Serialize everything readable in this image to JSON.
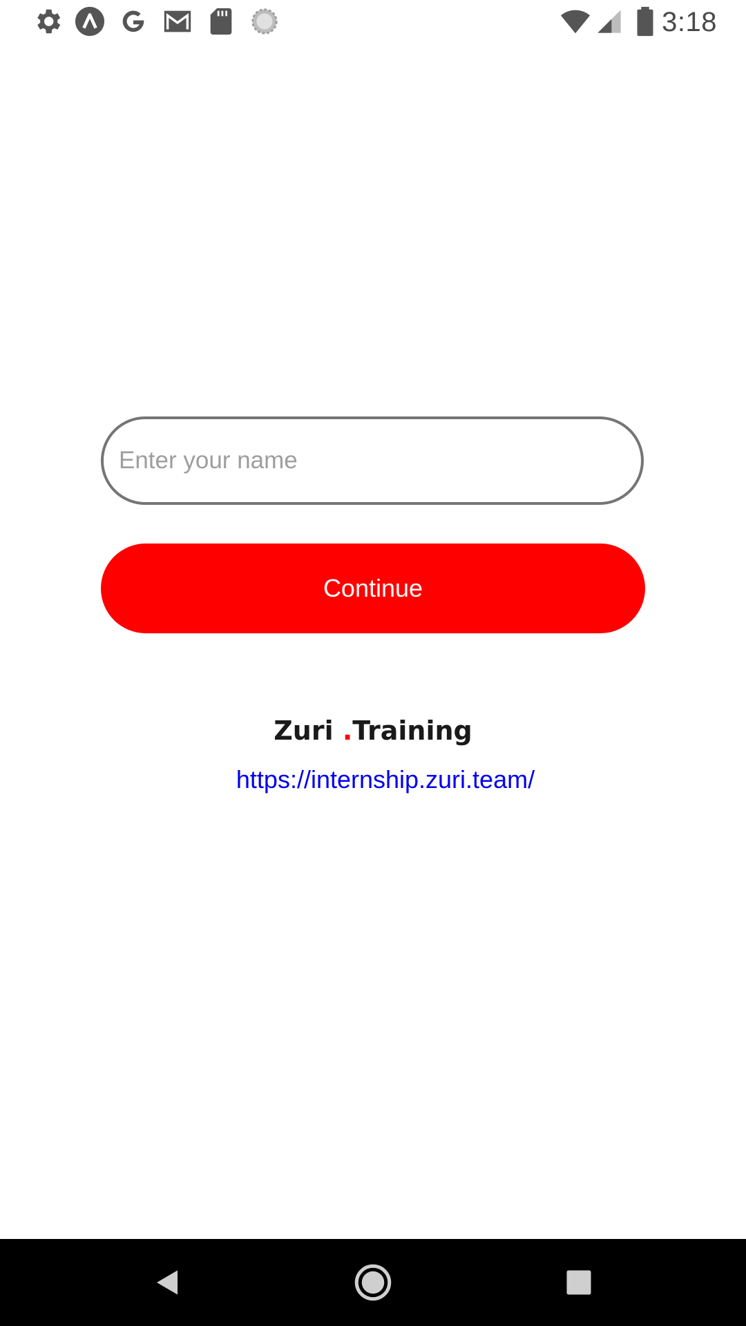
{
  "status_bar": {
    "time": "3:18",
    "left_icons": [
      "gear-icon",
      "lambda-icon",
      "google-icon",
      "gmail-icon",
      "sd-card-icon",
      "sync-circle-icon"
    ],
    "right_icons": [
      "wifi-icon",
      "signal-icon",
      "battery-icon"
    ]
  },
  "form": {
    "name_placeholder": "Enter your name",
    "name_value": "",
    "continue_label": "Continue"
  },
  "brand": {
    "logo_text_part1": "Zuri",
    "logo_dot": ".",
    "logo_text_part2": "Training",
    "link": "https://internship.zuri.team/"
  },
  "nav_bar": {
    "buttons": [
      "back-icon",
      "home-icon",
      "recents-icon"
    ]
  },
  "colors": {
    "accent": "#ff0000",
    "link": "#0000ee",
    "input_border": "#757575",
    "nav_background": "#000000"
  }
}
